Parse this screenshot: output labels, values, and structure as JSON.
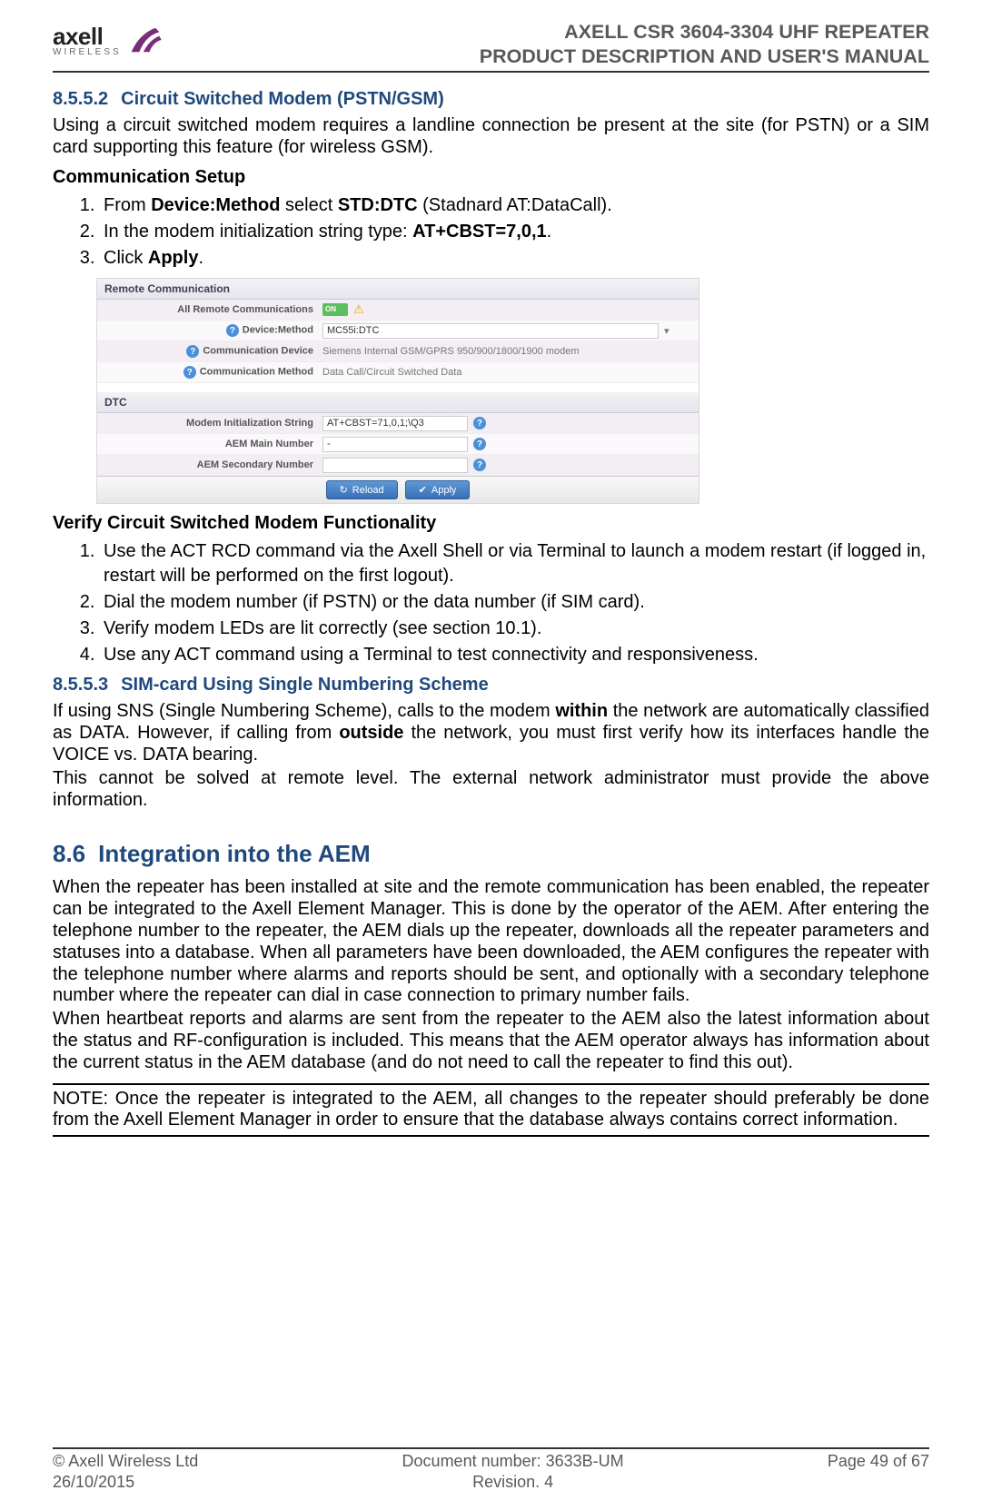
{
  "header": {
    "logo_text": "axell",
    "logo_sub": "WIRELESS",
    "title_line1": "AXELL CSR 3604-3304 UHF REPEATER",
    "title_line2": "PRODUCT DESCRIPTION AND USER'S MANUAL"
  },
  "section_8552": {
    "number": "8.5.5.2",
    "title": "Circuit Switched Modem (PSTN/GSM)",
    "intro": "Using a circuit switched modem requires a landline connection be present at the site (for PSTN) or a SIM card supporting this feature (for wireless GSM).",
    "setup_heading": "Communication Setup",
    "steps": [
      {
        "pre": "From ",
        "b1": "Device:Method",
        "mid": " select ",
        "b2": "STD:DTC",
        "post": " (Stadnard AT:DataCall)."
      },
      {
        "pre": "In the modem initialization string type: ",
        "b1": "AT+CBST=7,0,1",
        "post": "."
      },
      {
        "pre": "Click ",
        "b1": "Apply",
        "post": "."
      }
    ],
    "verify_heading": "Verify Circuit Switched Modem Functionality",
    "verify_steps": [
      "Use the ACT RCD command via the Axell Shell or via Terminal to launch a modem restart (if logged in, restart will be performed on the first logout).",
      "Dial the modem number (if PSTN) or the data number (if SIM card).",
      "Verify modem LEDs are lit correctly (see section 10.1).",
      "Use any ACT command using a Terminal to test connectivity and responsiveness."
    ]
  },
  "screenshot": {
    "panel1_title": "Remote Communication",
    "rows1": [
      {
        "label": "All Remote Communications",
        "toggle": "ON",
        "warn": true
      },
      {
        "label": "Device:Method",
        "help": true,
        "input": "MC55i:DTC",
        "dropdown": true
      },
      {
        "label": "Communication Device",
        "help": true,
        "text": "Siemens Internal GSM/GPRS 950/900/1800/1900 modem"
      },
      {
        "label": "Communication Method",
        "help": true,
        "text": "Data Call/Circuit Switched Data"
      }
    ],
    "panel2_title": "DTC",
    "rows2": [
      {
        "label": "Modem Initialization String",
        "input": "AT+CBST=71,0,1;\\Q3",
        "help_after": true
      },
      {
        "label": "AEM Main Number",
        "input": "-",
        "help_after": true
      },
      {
        "label": "AEM Secondary Number",
        "input": "",
        "help_after": true
      }
    ],
    "btn_reload": "Reload",
    "btn_apply": "Apply"
  },
  "section_8553": {
    "number": "8.5.5.3",
    "title": "SIM-card Using Single Numbering Scheme",
    "p1_pre": "If using SNS (Single Numbering Scheme), calls to the modem ",
    "p1_b1": "within",
    "p1_mid": " the network are automatically classified as DATA. However, if calling from ",
    "p1_b2": "outside",
    "p1_post": " the network, you must first verify how its interfaces handle the VOICE vs. DATA bearing.",
    "p2": "This cannot be solved at remote level. The external network administrator must provide the above information."
  },
  "section_86": {
    "number": "8.6",
    "title": "Integration into the AEM",
    "p1": "When the repeater has been installed at site and the remote communication has been enabled, the repeater can be integrated to the Axell Element Manager. This is done by the operator of the AEM. After entering the telephone number to the repeater, the AEM dials up the repeater, downloads all the repeater parameters and statuses into a database. When all parameters have been downloaded, the AEM configures the repeater with the telephone number where alarms and reports should be sent, and optionally with a secondary telephone number where the repeater can dial in case connection to primary number fails.",
    "p2": "When heartbeat reports and alarms are sent from the repeater to the AEM also the latest information about the status and RF-configuration is included. This means that the AEM operator always has information about the current status in the AEM database (and do not need to call the repeater to find this out).",
    "note": "NOTE: Once the repeater is integrated to the AEM, all changes to the repeater should preferably be done from the Axell Element Manager in order to ensure that the database always contains correct information."
  },
  "footer": {
    "left1": "© Axell Wireless Ltd",
    "left2": "26/10/2015",
    "center1": "Document number: 3633B-UM",
    "center2": "Revision. 4",
    "right1": "Page 49 of 67"
  }
}
